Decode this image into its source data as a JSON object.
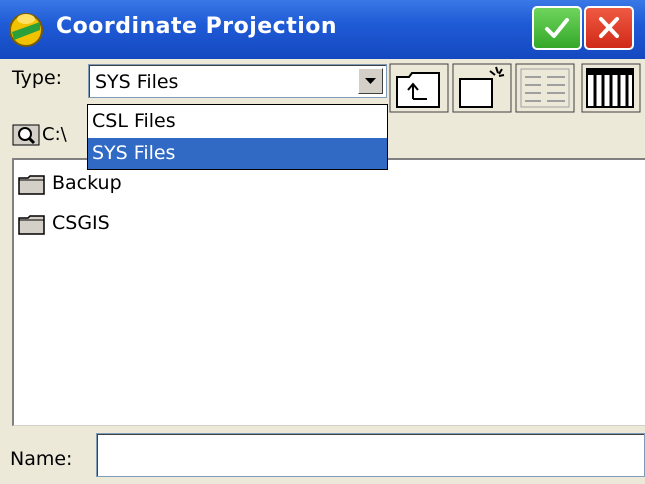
{
  "window": {
    "title": "Coordinate Projection"
  },
  "type": {
    "label": "Type:",
    "selected": "SYS Files",
    "options": [
      "CSL Files",
      "SYS Files"
    ]
  },
  "path": {
    "text": "C:\\"
  },
  "files": [
    {
      "name": "Backup",
      "icon": "folder-icon"
    },
    {
      "name": "CSGIS",
      "icon": "folder-icon"
    }
  ],
  "name_field": {
    "label": "Name:",
    "value": ""
  },
  "colors": {
    "title_bar": "#1f5bd6",
    "ok_button": "#34a829",
    "close_button": "#cf2a18",
    "selection": "#316ac5"
  },
  "icons": [
    "app-icon",
    "check-icon",
    "close-icon",
    "up-folder-icon",
    "new-folder-icon",
    "list-view-icon",
    "detail-view-icon",
    "search-folder-icon",
    "folder-icon"
  ]
}
